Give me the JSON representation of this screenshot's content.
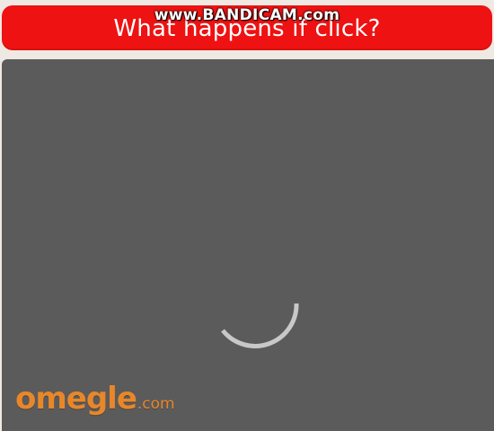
{
  "title_button": {
    "label": "What happens if click?"
  },
  "watermark": {
    "text": "www.BANDICAM.com"
  },
  "video": {
    "state": "loading",
    "spinner_icon": "loading-spinner-icon"
  },
  "logo": {
    "name": "omegle",
    "tld": ".com"
  },
  "colors": {
    "title_bg": "#ee1212",
    "title_text": "#ffffff",
    "panel_bg": "#5b5b5b",
    "page_bg": "#efe9e3",
    "logo": "#e8872a",
    "spinner": "#c8c8c8"
  }
}
